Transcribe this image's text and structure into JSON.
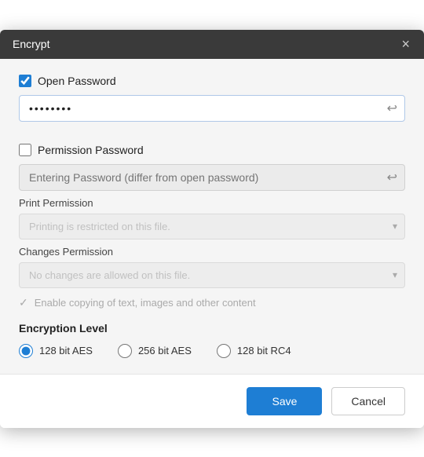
{
  "titleBar": {
    "title": "Encrypt",
    "closeIcon": "×"
  },
  "openPassword": {
    "checkboxLabel": "Open Password",
    "checked": true,
    "inputValue": "••••••••",
    "eyeIcon": "👁",
    "eyeIconUnicode": "⤳"
  },
  "permissionPassword": {
    "checkboxLabel": "Permission Password",
    "checked": false,
    "placeholder": "Entering Password (differ from open password)",
    "eyeIconUnicode": "⤳"
  },
  "printPermission": {
    "label": "Print Permission",
    "value": "Printing is restricted on this file.",
    "arrowIcon": "▾"
  },
  "changesPermission": {
    "label": "Changes Permission",
    "value": "No changes are allowed on this file.",
    "arrowIcon": "▾"
  },
  "copyContent": {
    "label": "Enable copying of text, images and other content"
  },
  "encryptionLevel": {
    "title": "Encryption Level",
    "options": [
      {
        "id": "aes128",
        "label": "128 bit AES",
        "selected": true
      },
      {
        "id": "aes256",
        "label": "256 bit AES",
        "selected": false
      },
      {
        "id": "rc4128",
        "label": "128 bit RC4",
        "selected": false
      }
    ]
  },
  "footer": {
    "saveLabel": "Save",
    "cancelLabel": "Cancel"
  }
}
